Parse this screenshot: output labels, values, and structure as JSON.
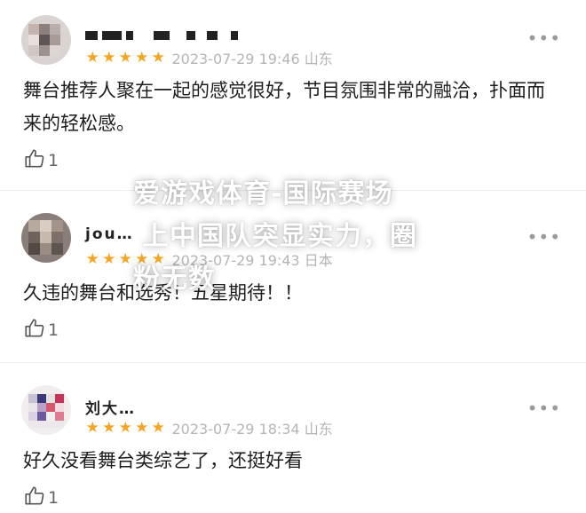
{
  "reviews": [
    {
      "username": "",
      "rating": 5,
      "timestamp": "2023-07-29 19:46",
      "location": "山东",
      "content": "舞台推荐人聚在一起的感觉很好，节目氛围非常的融洽，扑面而来的轻松感。",
      "likes": "1",
      "star_color": "#f5a524"
    },
    {
      "username": "jou…",
      "rating": 5,
      "timestamp": "2023-07-29 19:43",
      "location": "日本",
      "content": "久违的舞台和选秀！五星期待！！",
      "likes": "1",
      "star_color": "#f5a524"
    },
    {
      "username": "刘大…",
      "rating": 5,
      "timestamp": "2023-07-29 18:34",
      "location": "山东",
      "content": "好久没看舞台类综艺了，还挺好看",
      "likes": "1",
      "star_color": "#f5a524"
    }
  ],
  "icons": {
    "like": "thumbs-up-icon",
    "more": "more-dots-icon",
    "star": "star-icon"
  },
  "watermark": {
    "line1": "爱游戏体育-国际赛场",
    "line2": "上中国队突显实力，圈",
    "line3": "粉无数"
  }
}
